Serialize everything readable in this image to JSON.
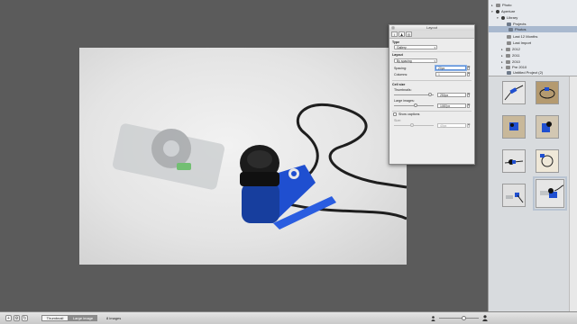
{
  "panel": {
    "title": "Layout",
    "tabs": [
      {
        "label": "i"
      },
      {
        "label": "♟"
      },
      {
        "label": "◎"
      }
    ],
    "type_heading": "Type",
    "type_value": "Gallery",
    "layout_heading": "Layout",
    "layout_value": "By spacing",
    "spacing_label": "Spacing:",
    "spacing_value": "20px",
    "columns_label": "Columns:",
    "columns_value": "5",
    "cell_size_heading": "Cell size",
    "thumbnails_label": "Thumbnails:",
    "thumbnails_value": "250px",
    "thumbnails_level": 0.92,
    "large_images_label": "Large images:",
    "large_images_value": "1087px",
    "large_images_level": 0.55,
    "show_captions_label": "Show captions",
    "size_label": "Size:",
    "size_value": "40px",
    "size_level": 0.45
  },
  "library": {
    "items": [
      {
        "label": "Photo",
        "level": 0,
        "icon": "photo-icon"
      },
      {
        "label": "Aperture",
        "level": 0,
        "icon": "aperture-icon"
      },
      {
        "label": "Library",
        "level": 1,
        "icon": "library-icon"
      },
      {
        "label": "Projects",
        "level": 2,
        "icon": "projects-icon"
      },
      {
        "label": "Photos",
        "level": 2,
        "icon": "photos-icon",
        "selected": true
      },
      {
        "label": "Last 12 Months",
        "level": 2,
        "icon": "calendar-icon"
      },
      {
        "label": "Last Import",
        "level": 2,
        "icon": "import-icon"
      },
      {
        "label": "2012",
        "level": 2,
        "icon": "folder-icon"
      },
      {
        "label": "2011",
        "level": 2,
        "icon": "folder-icon"
      },
      {
        "label": "2010",
        "level": 2,
        "icon": "folder-icon"
      },
      {
        "label": "Pre 2010",
        "level": 2,
        "icon": "folder-icon"
      },
      {
        "label": "Untitled Project (2)",
        "level": 2,
        "icon": "project-icon"
      }
    ]
  },
  "thumbnails": {
    "count": 8,
    "selected_index": 7
  },
  "bottombar": {
    "mode_thumbnail": "Thumbnail",
    "mode_large_image": "Large image",
    "active_mode": "Large image",
    "image_count": "8 images",
    "zoom_level": 0.62
  },
  "colors": {
    "canvas": "#5b5b5b",
    "sidebar_selection": "#a9b9cf",
    "earphone_blue": "#1f4fd0"
  }
}
